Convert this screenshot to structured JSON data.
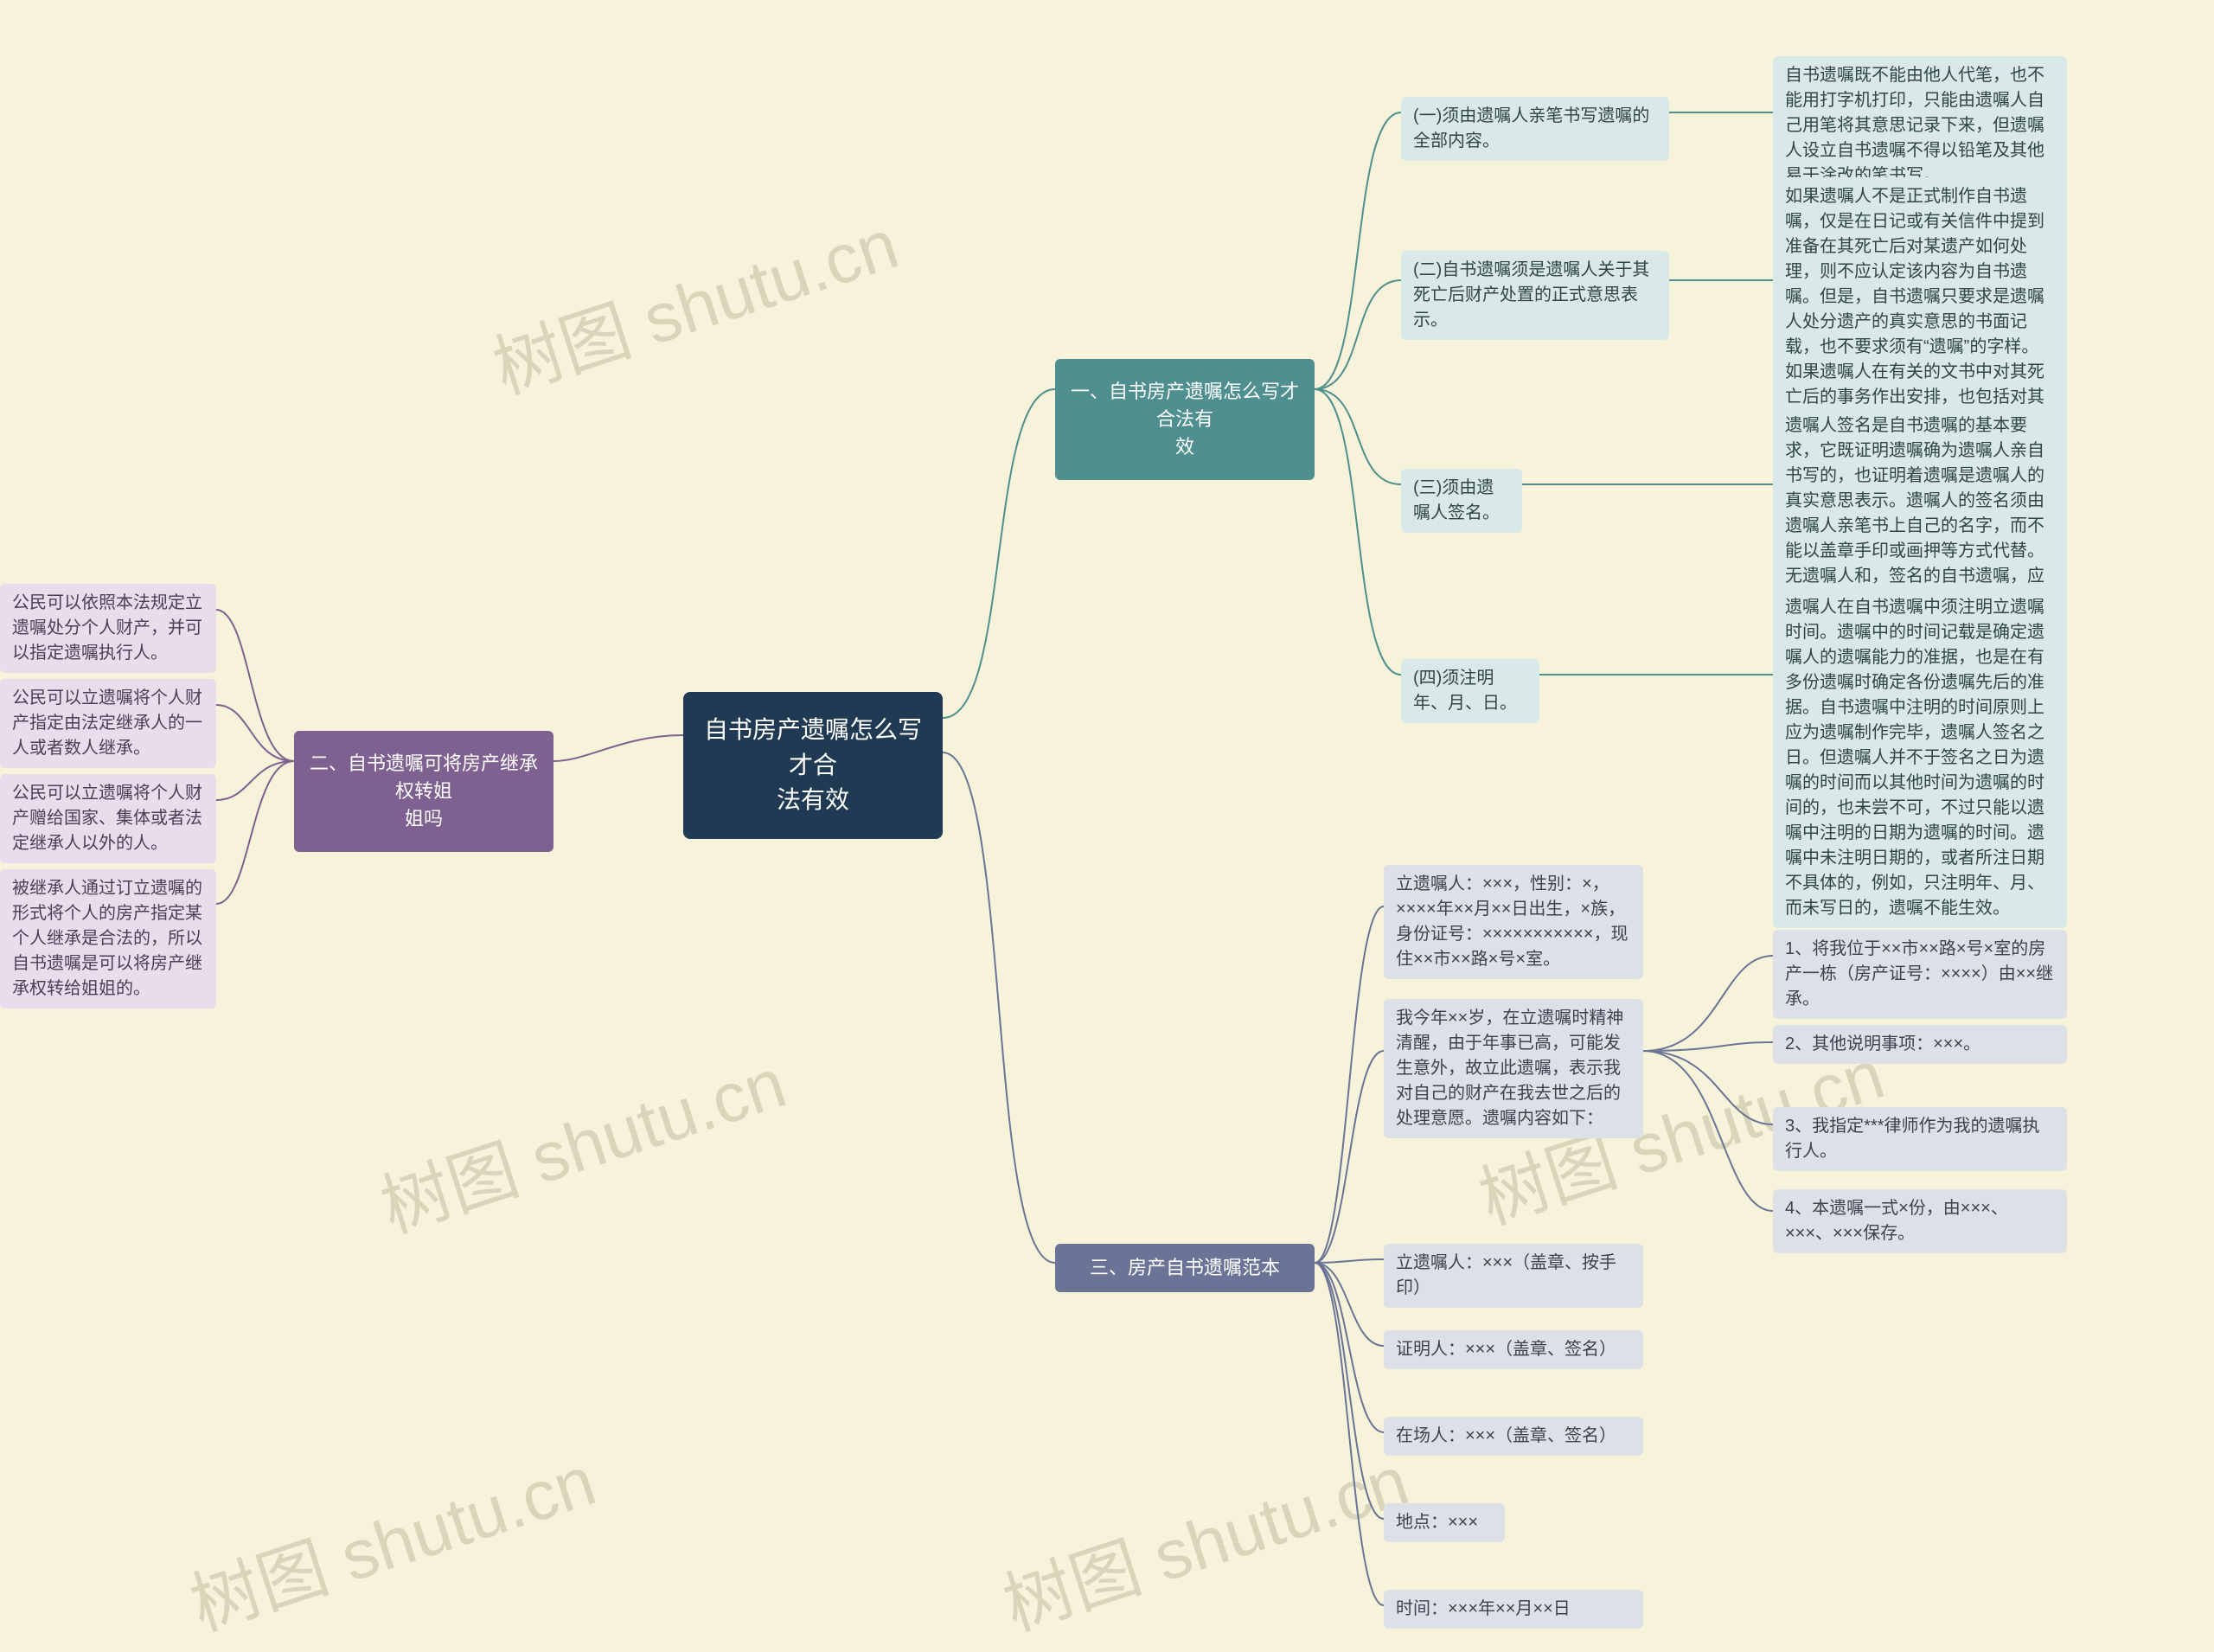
{
  "watermark": "树图 shutu.cn",
  "root": {
    "title": "自书房产遗嘱怎么写才合\n法有效"
  },
  "branch1": {
    "title": "一、自书房产遗嘱怎么写才合法有\n效",
    "items": [
      {
        "label": "(一)须由遗嘱人亲笔书写遗嘱的全部内容。",
        "detail": "自书遗嘱既不能由他人代笔，也不能用打字机打印，只能由遗嘱人自己用笔将其意思记录下来，但遗嘱人设立自书遗嘱不得以铅笔及其他易于涂改的笔书写。"
      },
      {
        "label": "(二)自书遗嘱须是遗嘱人关于其死亡后财产处置的正式意思表示。",
        "detail": "如果遗嘱人不是正式制作自书遗嘱，仅是在日记或有关信件中提到准备在其死亡后对某遗产如何处理，则不应认定该内容为自书遗嘱。但是，自书遗嘱只要求是遗嘱人处分遗产的真实意思的书面记载，也不要求须有“遗嘱”的字样。如果遗嘱人在有关的文书中对其死亡后的事务作出安排，也包括对其死亡后的财产处理作出安排，而又无相反证明时，则应当认定该文书为遗嘱人的自书遗嘱。"
      },
      {
        "label": "(三)须由遗嘱人签名。",
        "detail": "遗嘱人签名是自书遗嘱的基本要求，它既证明遗嘱确为遗嘱人亲自书写的，也证明着遗嘱是遗嘱人的真实意思表示。遗嘱人的签名须由遗嘱人亲笔书上自己的名字，而不能以盖章手印或画押等方式代替。无遗嘱人和，签名的自书遗嘱，应为无效。自书遗嘱如需涂改、增删时，遗嘱人也须于涂改、增删处签名并注明时间，否则，其涂改、增删的内容无效。"
      },
      {
        "label": "(四)须注明年、月、日。",
        "detail": "遗嘱人在自书遗嘱中须注明立遗嘱时间。遗嘱中的时间记载是确定遗嘱人的遗嘱能力的准据，也是在有多份遗嘱时确定各份遗嘱先后的准据。自书遗嘱中注明的时间原则上应为遗嘱制作完毕，遗嘱人签名之日。但遗嘱人并不于签名之日为遗嘱的时间而以其他时间为遗嘱的时间的，也未尝不可，不过只能以遗嘱中注明的日期为遗嘱的时间。遗嘱中未注明日期的，或者所注日期不具体的，例如，只注明年、月、而未写日的，遗嘱不能生效。"
      }
    ]
  },
  "branch2": {
    "title": "二、自书遗嘱可将房产继承权转姐\n姐吗",
    "items": [
      "公民可以依照本法规定立遗嘱处分个人财产，并可以指定遗嘱执行人。",
      "公民可以立遗嘱将个人财产指定由法定继承人的一人或者数人继承。",
      "公民可以立遗嘱将个人财产赠给国家、集体或者法定继承人以外的人。",
      "被继承人通过订立遗嘱的形式将个人的房产指定某个人继承是合法的，所以自书遗嘱是可以将房产继承权转给姐姐的。"
    ]
  },
  "branch3": {
    "title": "三、房产自书遗嘱范本",
    "items": [
      "立遗嘱人：×××，性别：×，××××年××月××日出生，×族，身份证号：×××××××××××，现住××市××路×号×室。",
      "我今年××岁，在立遗嘱时精神清醒，由于年事已高，可能发生意外，故立此遗嘱，表示我对自己的财产在我去世之后的处理意愿。遗嘱内容如下：",
      "立遗嘱人：×××（盖章、按手印）",
      "证明人：×××（盖章、签名）",
      "在场人：×××（盖章、签名）",
      "地点：×××",
      "时间：×××年××月××日"
    ],
    "subitems": [
      "1、将我位于××市××路×号×室的房产一栋（房产证号：××××）由××继承。",
      "2、其他说明事项：×××。",
      "3、我指定***律师作为我的遗嘱执行人。",
      "4、本遗嘱一式×份，由×××、×××、×××保存。"
    ]
  }
}
